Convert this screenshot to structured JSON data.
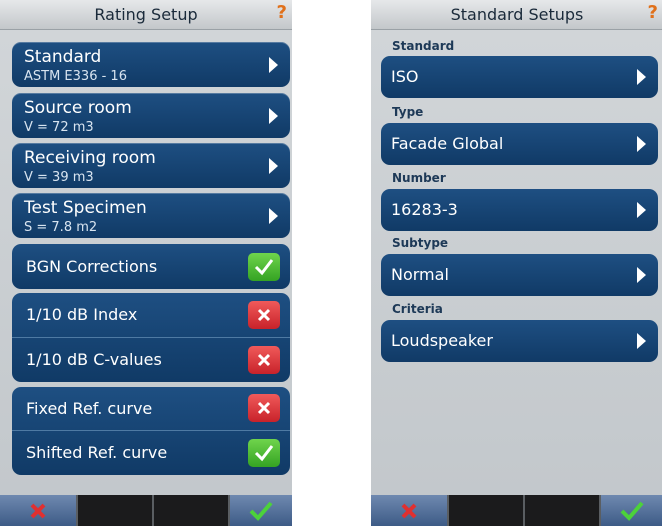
{
  "left": {
    "title": "Rating Setup",
    "help": "?",
    "nav_items": [
      {
        "label": "Standard",
        "value": "ASTM E336 - 16"
      },
      {
        "label": "Source room",
        "value": "V = 72 m3"
      },
      {
        "label": "Receiving room",
        "value": "V = 39 m3"
      },
      {
        "label": "Test Specimen",
        "value": "S = 7.8 m2"
      }
    ],
    "toggles": [
      {
        "label": "BGN Corrections",
        "state": "on"
      },
      {
        "label": "1/10 dB Index",
        "state": "off"
      },
      {
        "label": "1/10 dB C-values",
        "state": "off"
      },
      {
        "label": "Fixed Ref. curve",
        "state": "off"
      },
      {
        "label": "Shifted Ref. curve",
        "state": "on"
      }
    ]
  },
  "right": {
    "title": "Standard Setups",
    "help": "?",
    "fields": [
      {
        "section": "Standard",
        "value": "ISO"
      },
      {
        "section": "Type",
        "value": "Facade Global"
      },
      {
        "section": "Number",
        "value": "16283-3"
      },
      {
        "section": "Subtype",
        "value": "Normal"
      },
      {
        "section": "Criteria",
        "value": "Loudspeaker"
      }
    ]
  },
  "colors": {
    "card": "#174778",
    "ok": "#4cc234",
    "cancel": "#d8282f",
    "help": "#e0701a"
  }
}
